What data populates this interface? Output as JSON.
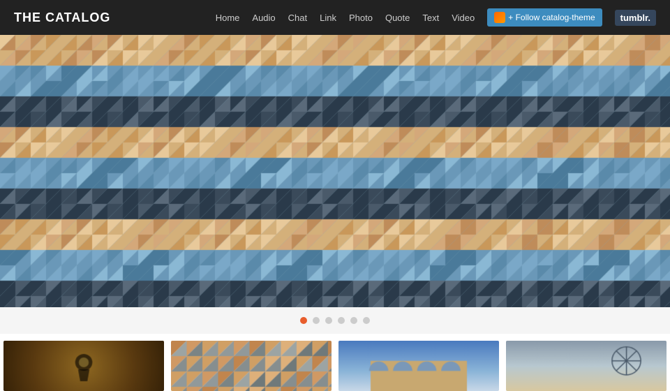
{
  "header": {
    "title": "THE CATALOG",
    "nav_items": [
      "Home",
      "Audio",
      "Chat",
      "Link",
      "Photo",
      "Quote",
      "Text",
      "Video"
    ],
    "follow_label": "+ Follow catalog-theme",
    "tumblr_label": "tumblr."
  },
  "hero": {
    "alt": "Geometric triangle mosaic pattern in blue and tan"
  },
  "dots": {
    "count": 6,
    "active_index": 0
  },
  "thumbnails": [
    {
      "alt": "Keyhole silhouette dark brown"
    },
    {
      "alt": "Geometric triangles orange tan"
    },
    {
      "alt": "Architecture arched building blue sky"
    },
    {
      "alt": "London Eye ferris wheel clouds"
    }
  ]
}
